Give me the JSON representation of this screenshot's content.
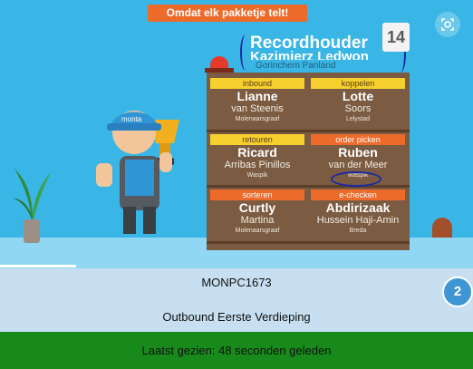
{
  "banner": {
    "topbar_text": "Omdat elk pakketje telt!",
    "title": "Recordhouder",
    "name": "Kazimierz Ledwon",
    "place": "Gorinchem Panland",
    "calendar_day": "14",
    "worker_cap_text": "monta"
  },
  "board": {
    "cells": [
      {
        "category": "inbound",
        "first": "Lianne",
        "last": "van Steenis",
        "city": "Molenaarsgraaf"
      },
      {
        "category": "koppelen",
        "first": "Lotte",
        "last": "Soors",
        "city": "Lelystad"
      },
      {
        "category": "retouren",
        "first": "Ricard",
        "last": "Arribas Pinillos",
        "city": "Waspik"
      },
      {
        "category": "order picken",
        "first": "Ruben",
        "last": "van der Meer",
        "city": "Waspik"
      },
      {
        "category": "sorteren",
        "first": "Curtly",
        "last": "Martina",
        "city": "Molenaarsgraaf"
      },
      {
        "category": "e-checken",
        "first": "Abdirizaak",
        "last": "Hussein Haji-Amin",
        "city": "Breda"
      }
    ]
  },
  "device": {
    "name": "MONPC1673",
    "location": "Outbound Eerste Verdieping",
    "badge_count": "2"
  },
  "status": {
    "text": "Laatst gezien: 48 seconden geleden"
  },
  "colors": {
    "banner_blue": "#39b6e6",
    "accent_orange": "#ec6a2a",
    "accent_yellow": "#f6d02e",
    "status_green": "#188a1c",
    "card_bg": "#c7dff0"
  }
}
